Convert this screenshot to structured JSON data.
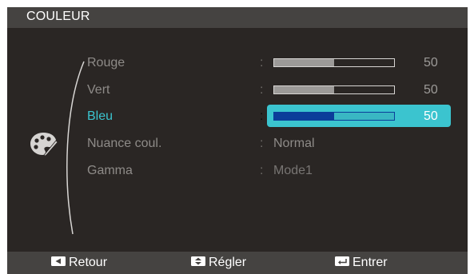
{
  "menu": {
    "title": "COULEUR"
  },
  "items": [
    {
      "label": "Rouge",
      "type": "slider",
      "value": 50,
      "display_value": "50",
      "max": 100
    },
    {
      "label": "Vert",
      "type": "slider",
      "value": 50,
      "display_value": "50",
      "max": 100
    },
    {
      "label": "Bleu",
      "type": "slider",
      "value": 50,
      "display_value": "50",
      "max": 100,
      "selected": true
    },
    {
      "label": "Nuance coul.",
      "type": "option",
      "value": "Normal"
    },
    {
      "label": "Gamma",
      "type": "option",
      "value": "Mode1"
    }
  ],
  "separator": ":",
  "footer": {
    "back_label": "Retour",
    "adjust_label": "Régler",
    "enter_label": "Entrer"
  },
  "icons": {
    "menu_icon": "palette-icon",
    "back_key": "left-arrow-key-icon",
    "adjust_key": "up-down-arrow-key-icon",
    "enter_key": "enter-key-icon"
  },
  "colors": {
    "background": "#2a2624",
    "bars": "#454341",
    "accent": "#3bc4cf",
    "selected_fill": "#0b3d9a",
    "text": "#8e8b88"
  }
}
